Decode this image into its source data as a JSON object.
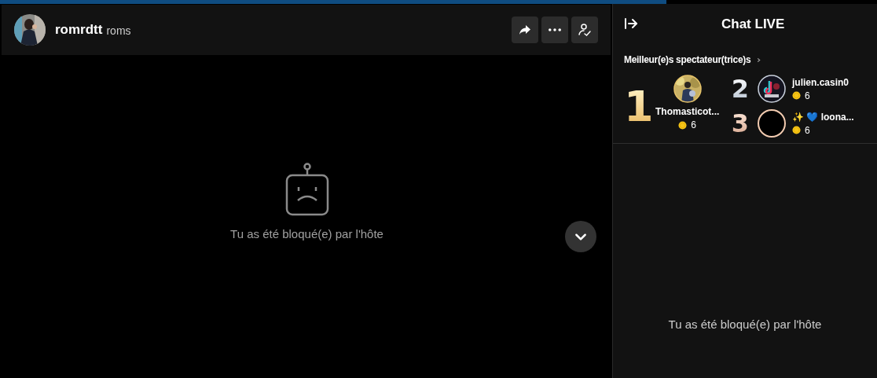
{
  "header": {
    "display_name": "romrdtt",
    "username": "roms",
    "buttons": [
      {
        "kind": "share"
      },
      {
        "kind": "more"
      },
      {
        "kind": "follow"
      }
    ]
  },
  "stream": {
    "message": "Tu as été bloqué(e) par l'hôte"
  },
  "chat": {
    "title": "Chat LIVE",
    "top_viewers": {
      "heading": "Meilleur(e)s spectateur(trice)s",
      "viewers": [
        {
          "rank": "1",
          "name": "Thomasticot...",
          "coins": "6",
          "kind": "picture"
        },
        {
          "rank": "2",
          "name": "julien.casin0",
          "coins": "6",
          "kind": "picture"
        },
        {
          "rank": "3",
          "name": "✨ 💙 loona...",
          "coins": "6",
          "kind": "blank"
        }
      ]
    },
    "message": "Tu as été bloqué(e) par l'hôte"
  }
}
